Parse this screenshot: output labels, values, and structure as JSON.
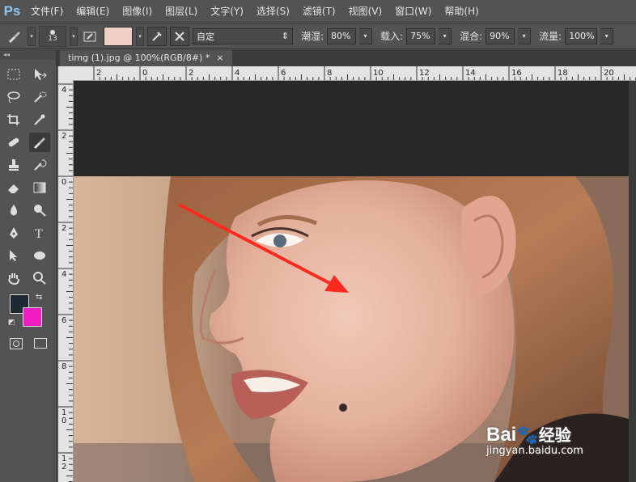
{
  "app": {
    "logo": "Ps"
  },
  "menu": [
    "文件(F)",
    "编辑(E)",
    "图像(I)",
    "图层(L)",
    "文字(Y)",
    "选择(S)",
    "滤镜(T)",
    "视图(V)",
    "窗口(W)",
    "帮助(H)"
  ],
  "options": {
    "brush_size": "13",
    "preset": "自定",
    "wet_label": "潮湿:",
    "wet_value": "80%",
    "load_label": "载入:",
    "load_value": "75%",
    "mix_label": "混合:",
    "mix_value": "90%",
    "flow_label": "流量:",
    "flow_value": "100%",
    "swatch_color": "#f0cfc6"
  },
  "toolbar": {
    "collapse": "◂◂"
  },
  "colors": {
    "foreground": "#1d2a36",
    "background": "#ee1ec0"
  },
  "document": {
    "tab_title": "timg (1).jpg @ 100%(RGB/8#) *",
    "close": "×"
  },
  "rulers": {
    "h_labels": [
      "2",
      "0",
      "2",
      "4",
      "6",
      "8",
      "10",
      "12",
      "14",
      "16",
      "18",
      "20",
      "22",
      "24"
    ],
    "v_labels": [
      "4",
      "2",
      "0",
      "2",
      "4",
      "6",
      "8",
      "10",
      "12"
    ]
  },
  "watermark": {
    "brand": "Bai",
    "brand2": "经验",
    "url": "jingyan.baidu.com"
  },
  "annotation": {
    "arrow_color": "#ff2a1f"
  }
}
